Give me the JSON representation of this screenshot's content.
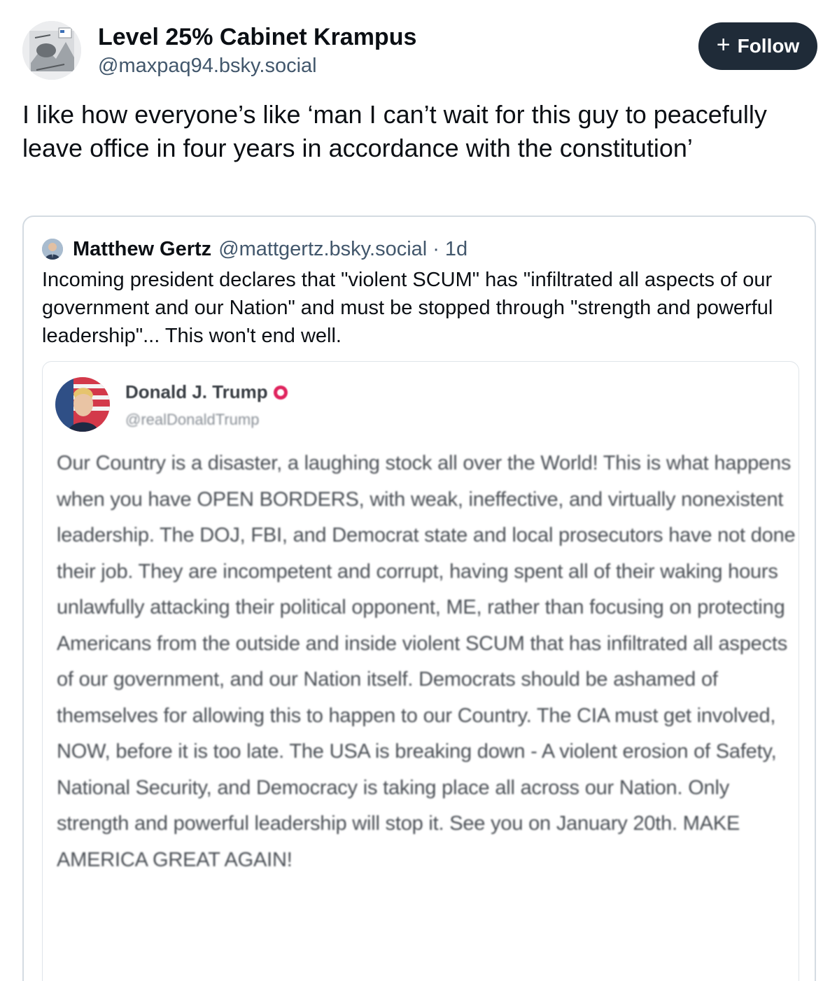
{
  "post": {
    "author_name": "Level 25% Cabinet Krampus",
    "author_handle": "@maxpaq94.bsky.social",
    "follow_label": "Follow",
    "text": "I like how everyone’s like ‘man I can’t wait for this guy to peacefully leave office in four years in accordance with the constitution’"
  },
  "quote": {
    "author_name": "Matthew Gertz",
    "author_handle": "@mattgertz.bsky.social",
    "separator": "·",
    "time": "1d",
    "text": "Incoming president declares that \"violent SCUM\" has \"infiltrated all aspects of our government and our Nation\" and must be stopped through \"strength and powerful leadership\"... This won't end well."
  },
  "embedded_post": {
    "author_name": "Donald J. Trump",
    "author_handle": "@realDonaldTrump",
    "text": "Our Country is a disaster, a laughing stock all over the World! This is what happens when you have OPEN BORDERS, with weak, ineffective, and virtually nonexistent leadership. The DOJ, FBI, and Democrat state and local prosecutors have not done their job. They are incompetent and corrupt, having spent all of their waking hours unlawfully attacking their political opponent, ME, rather than focusing on protecting Americans from the outside and inside violent SCUM that has infiltrated all aspects of our government, and our Nation itself. Democrats should be ashamed of themselves for allowing this to happen to our Country. The CIA must get involved, NOW, before it is too late. The USA is breaking down - A violent erosion of Safety, National Security, and Democracy is taking place all across our Nation. Only strength and powerful leadership will stop it. See you on January 20th. MAKE AMERICA GREAT AGAIN!"
  },
  "colors": {
    "follow_bg": "#1f2b38",
    "handle": "#42576c",
    "card_border": "#d4dbe2",
    "verified": "#e0245e"
  }
}
